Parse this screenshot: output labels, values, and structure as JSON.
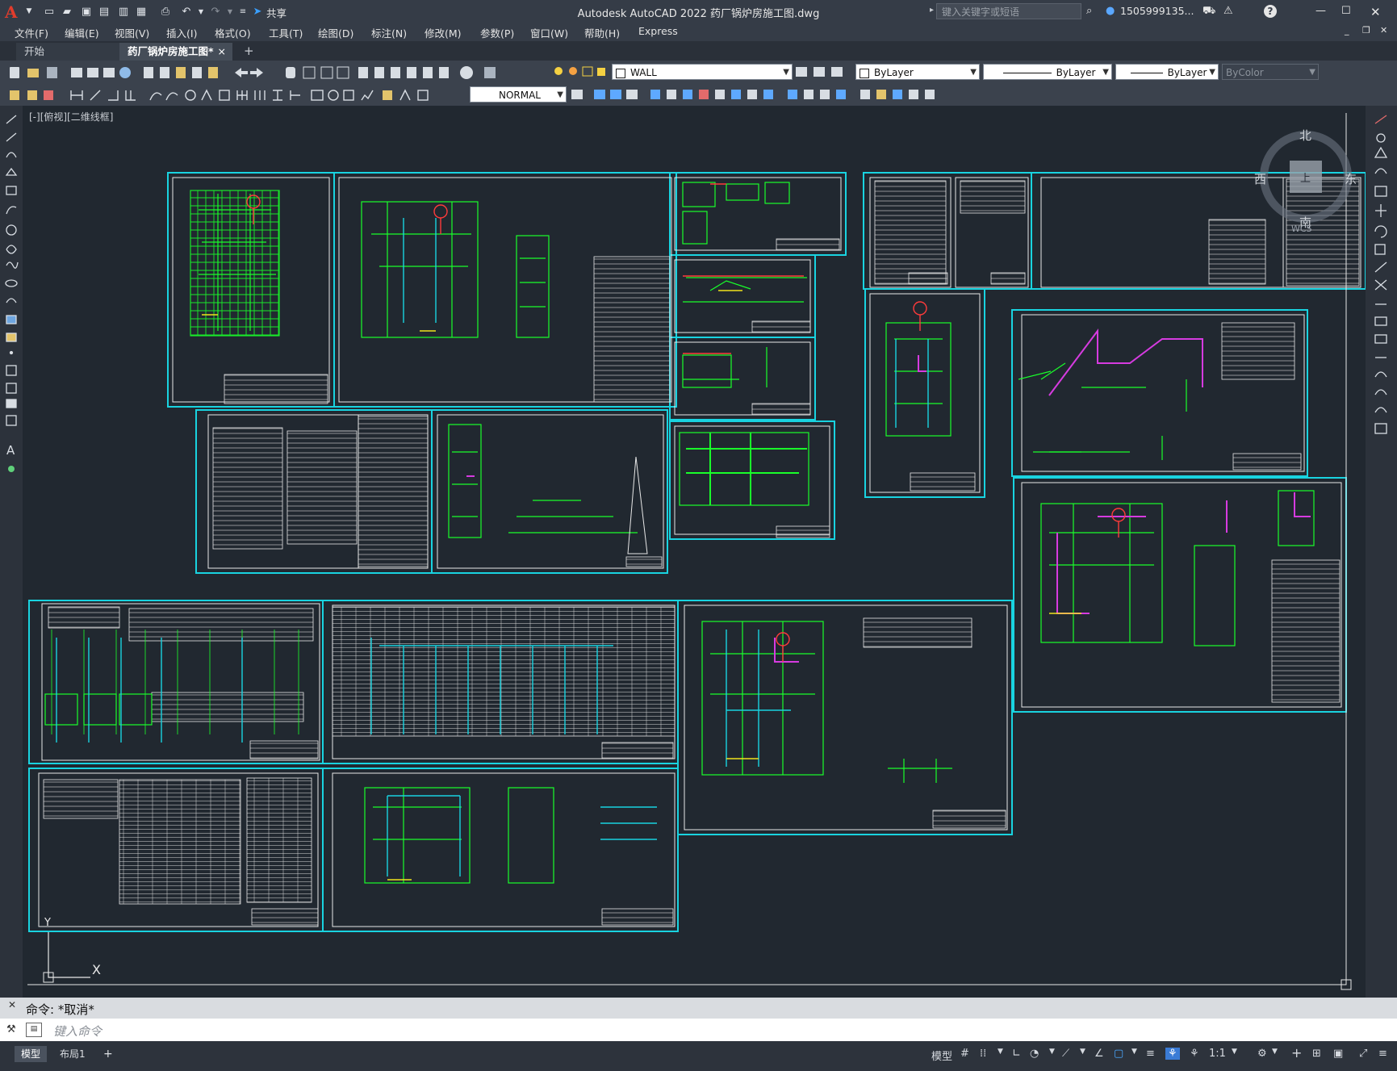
{
  "titlebar": {
    "app_icon": "A",
    "share_label": "共享",
    "title": "Autodesk AutoCAD 2022    药厂锅炉房施工图.dwg",
    "search_placeholder": "键入关键字或短语",
    "user": "1505999135...",
    "help_icon": "?"
  },
  "menu": [
    "文件(F)",
    "编辑(E)",
    "视图(V)",
    "插入(I)",
    "格式(O)",
    "工具(T)",
    "绘图(D)",
    "标注(N)",
    "修改(M)",
    "参数(P)",
    "窗口(W)",
    "帮助(H)",
    "Express"
  ],
  "tabs": {
    "start": "开始",
    "drawing": "药厂锅炉房施工图*",
    "close": "×",
    "add": "+"
  },
  "toolbar": {
    "layer_value": "WALL",
    "color_value": "ByLayer",
    "linetype_value": "ByLayer",
    "lineweight_value": "ByLayer",
    "plotstyle_value": "ByColor",
    "textstyle_value": "NORMAL"
  },
  "canvas": {
    "view_label": "[-][俯视][二维线框]",
    "viewcube": {
      "north": "北",
      "west": "西",
      "south": "南",
      "east": "东",
      "top": "上",
      "wcs": "WCS"
    },
    "ucs_y": "Y",
    "ucs_x": "X"
  },
  "command": {
    "history": "命令: *取消*",
    "placeholder": "键入命令"
  },
  "statusbar": {
    "model_tab": "模型",
    "layout_tab": "布局1",
    "add_tab": "+",
    "model_label": "模型",
    "scale": "1:1"
  },
  "colors": {
    "background": "#212830",
    "frame": "#19d3e0",
    "green": "#19ff2a",
    "magenta": "#d63be0",
    "white": "#e8e8e8",
    "yellow": "#f0e21c",
    "red": "#ff3b3b"
  }
}
